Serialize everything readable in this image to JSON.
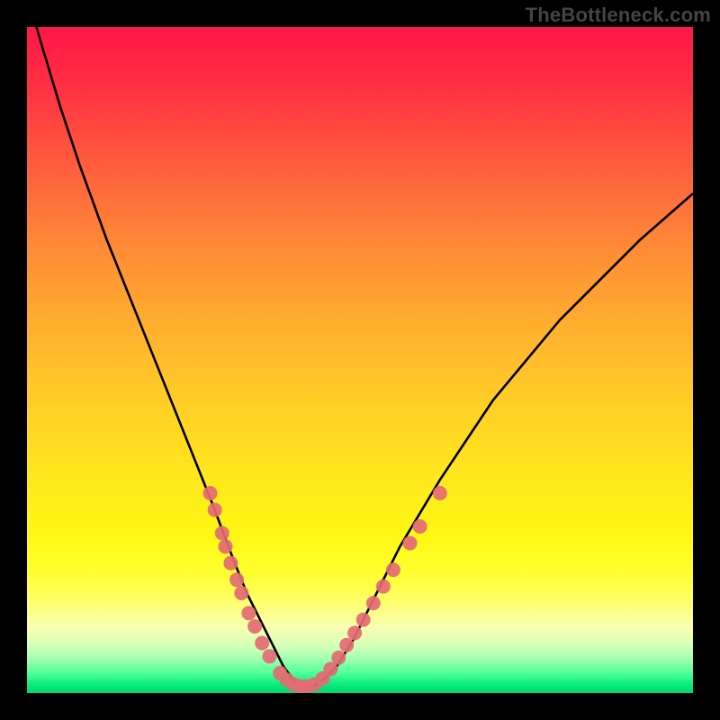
{
  "watermark": "TheBottleneck.com",
  "colors": {
    "frame": "#000000",
    "curve": "#000000",
    "marker": "#e46a74",
    "gradient_top": "#ff1846",
    "gradient_bottom": "#00d86a"
  },
  "chart_data": {
    "type": "line",
    "title": "",
    "xlabel": "",
    "ylabel": "",
    "xlim": [
      0,
      100
    ],
    "ylim": [
      0,
      100
    ],
    "grid": false,
    "legend": false,
    "series": [
      {
        "name": "bottleneck-curve",
        "x": [
          0,
          2,
          5,
          8,
          12,
          16,
          20,
          24,
          28,
          31,
          33,
          35,
          37,
          38.5,
          40,
          41.5,
          43,
          44.5,
          46.5,
          49,
          52,
          56,
          62,
          70,
          80,
          92,
          100
        ],
        "y": [
          105,
          98,
          88,
          79,
          68,
          58,
          48,
          38,
          28,
          20,
          15,
          11,
          7,
          4,
          2,
          1,
          1,
          2,
          4,
          8,
          14,
          22,
          32,
          44,
          56,
          68,
          75
        ]
      }
    ],
    "markers": [
      {
        "x": 27.5,
        "y": 30
      },
      {
        "x": 28.2,
        "y": 27.5
      },
      {
        "x": 29.3,
        "y": 24
      },
      {
        "x": 29.8,
        "y": 22
      },
      {
        "x": 30.6,
        "y": 19.5
      },
      {
        "x": 31.5,
        "y": 17
      },
      {
        "x": 32.2,
        "y": 15
      },
      {
        "x": 33.3,
        "y": 12
      },
      {
        "x": 34.2,
        "y": 10
      },
      {
        "x": 35.3,
        "y": 7.5
      },
      {
        "x": 36.4,
        "y": 5.5
      },
      {
        "x": 38.0,
        "y": 3
      },
      {
        "x": 39.0,
        "y": 2
      },
      {
        "x": 40.0,
        "y": 1.3
      },
      {
        "x": 41.0,
        "y": 1
      },
      {
        "x": 42.0,
        "y": 1
      },
      {
        "x": 43.2,
        "y": 1.3
      },
      {
        "x": 44.4,
        "y": 2.2
      },
      {
        "x": 45.6,
        "y": 3.6
      },
      {
        "x": 46.8,
        "y": 5.3
      },
      {
        "x": 48.0,
        "y": 7.2
      },
      {
        "x": 49.2,
        "y": 9
      },
      {
        "x": 50.5,
        "y": 11
      },
      {
        "x": 52.0,
        "y": 13.5
      },
      {
        "x": 53.5,
        "y": 16
      },
      {
        "x": 55.0,
        "y": 18.5
      },
      {
        "x": 57.5,
        "y": 22.5
      },
      {
        "x": 59.0,
        "y": 25
      },
      {
        "x": 62.0,
        "y": 30
      }
    ]
  }
}
